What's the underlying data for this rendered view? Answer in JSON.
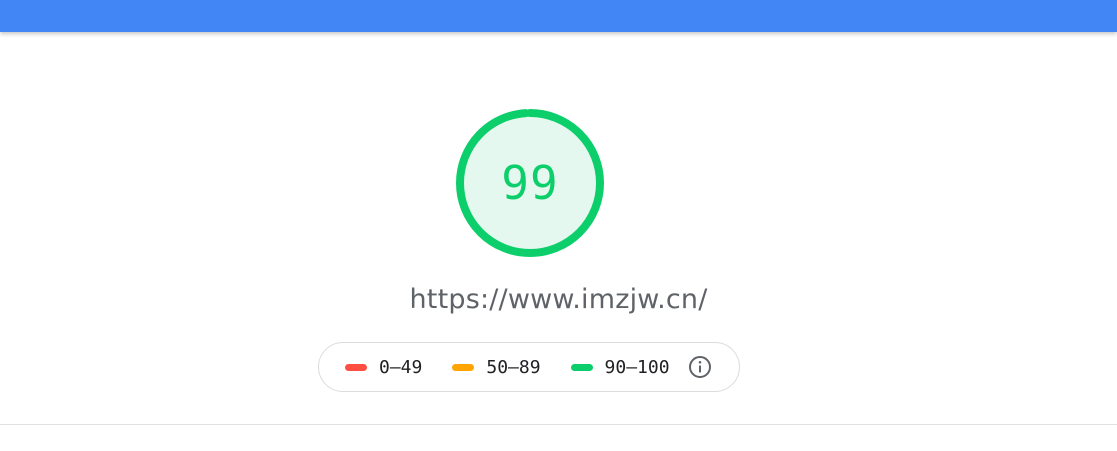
{
  "colors": {
    "header": "#4285f4",
    "pass": "#0cce6b",
    "average": "#ffa400",
    "fail": "#ff4e42",
    "gauge_fill": "#e5f8ef",
    "url_text": "#5f6368"
  },
  "gauge": {
    "score": "99",
    "progress": 0.99
  },
  "url": "https://www.imzjw.cn/",
  "legend": {
    "items": [
      {
        "label": "0–49",
        "color": "#ff4e42"
      },
      {
        "label": "50–89",
        "color": "#ffa400"
      },
      {
        "label": "90–100",
        "color": "#0cce6b"
      }
    ],
    "info_icon": "info-circle-icon"
  }
}
